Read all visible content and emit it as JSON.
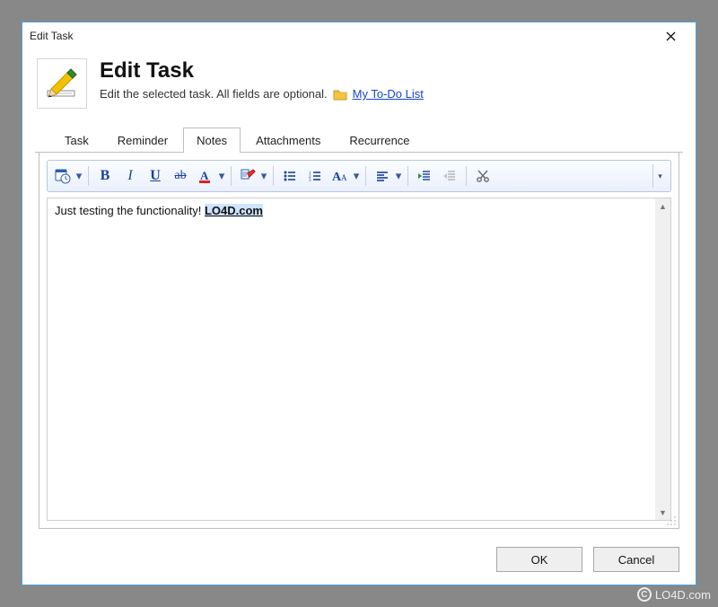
{
  "window": {
    "title": "Edit Task",
    "close_name": "close-icon"
  },
  "header": {
    "title": "Edit Task",
    "subtitle": "Edit the selected task. All fields are optional.",
    "link_label": "My To-Do List"
  },
  "tabs": [
    {
      "label": "Task",
      "active": false
    },
    {
      "label": "Reminder",
      "active": false
    },
    {
      "label": "Notes",
      "active": true
    },
    {
      "label": "Attachments",
      "active": false
    },
    {
      "label": "Recurrence",
      "active": false
    }
  ],
  "toolbar": {
    "buttons": [
      "insert-date",
      "bold",
      "italic",
      "underline",
      "strikethrough",
      "font-color",
      "highlight",
      "bullet-list",
      "number-list",
      "font-size",
      "align",
      "indent",
      "outdent",
      "cut"
    ]
  },
  "editor": {
    "text_prefix": "Just testing the functionality!   ",
    "link_text": "LO4D.com"
  },
  "footer": {
    "ok": "OK",
    "cancel": "Cancel"
  },
  "watermark": "LO4D.com"
}
